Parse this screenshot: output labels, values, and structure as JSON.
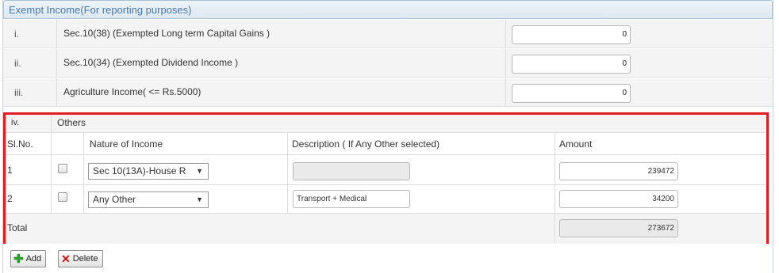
{
  "section": {
    "title": "Exempt Income(For reporting purposes)"
  },
  "rows": [
    {
      "index": "i.",
      "label": "Sec.10(38) (Exempted Long term Capital Gains )",
      "value": "0"
    },
    {
      "index": "ii.",
      "label": "Sec.10(34) (Exempted Dividend Income )",
      "value": "0"
    },
    {
      "index": "iii.",
      "label": "Agriculture Income( <= Rs.5000)",
      "value": "0"
    }
  ],
  "others": {
    "index": "iv.",
    "label": "Others",
    "headers": {
      "slno": "Sl.No.",
      "nature": "Nature of Income",
      "description": "Description ( If Any Other selected)",
      "amount": "Amount"
    },
    "items": [
      {
        "slno": "1",
        "nature": "Sec 10(13A)-House R",
        "description": "",
        "amount": "239472"
      },
      {
        "slno": "2",
        "nature": "Any Other",
        "description": "Transport + Medical",
        "amount": "34200"
      }
    ],
    "total_label": "Total",
    "total_value": "273672"
  },
  "buttons": {
    "add": "Add",
    "delete": "Delete"
  },
  "icons": {
    "add": "plus-icon",
    "delete": "x-icon",
    "dropdown": "chevron-down-icon"
  },
  "colors": {
    "highlight_border": "#e21b24",
    "header_text": "#4a79a8",
    "add_icon": "#2e9a2e",
    "delete_icon": "#d21010"
  }
}
